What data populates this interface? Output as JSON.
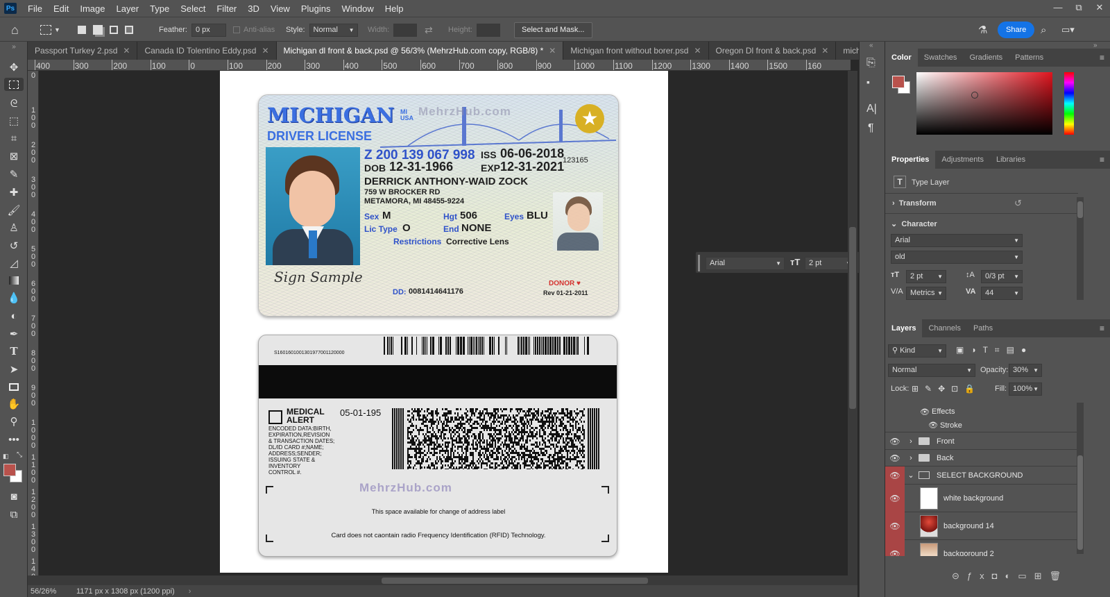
{
  "app": {
    "logo": "Ps"
  },
  "menu": [
    "File",
    "Edit",
    "Image",
    "Layer",
    "Type",
    "Select",
    "Filter",
    "3D",
    "View",
    "Plugins",
    "Window",
    "Help"
  ],
  "window_controls": {
    "minimize": "—",
    "restore": "⧉",
    "close": "✕"
  },
  "options": {
    "feather_label": "Feather:",
    "feather_value": "0 px",
    "antialias_label": "Anti-alias",
    "style_label": "Style:",
    "style_value": "Normal",
    "width_label": "Width:",
    "height_label": "Height:",
    "select_mask_label": "Select and Mask...",
    "share_label": "Share"
  },
  "tabs": [
    {
      "label": "Passport Turkey 2.psd",
      "active": false
    },
    {
      "label": "Canada ID Tolentino Eddy.psd",
      "active": false
    },
    {
      "label": "Michigan dl front & back.psd @ 56/3% (MehrzHub.com copy, RGB/8) *",
      "active": true
    },
    {
      "label": "Michigan front without borer.psd",
      "active": false
    },
    {
      "label": "Oregon Dl front & back.psd",
      "active": false
    },
    {
      "label": "michig",
      "active": false
    }
  ],
  "ruler_h": [
    "400",
    "300",
    "200",
    "100",
    "0",
    "100",
    "200",
    "300",
    "400",
    "500",
    "600",
    "700",
    "800",
    "900",
    "1000",
    "1100",
    "1200",
    "1300",
    "1400",
    "1500",
    "160"
  ],
  "ruler_v": [
    "0",
    "1\n0\n0",
    "2\n0\n0",
    "3\n0\n0",
    "4\n0\n0",
    "5\n0\n0",
    "6\n0\n0",
    "7\n0\n0",
    "8\n0\n0",
    "9\n0\n0",
    "1\n0\n0\n0",
    "1\n1\n0\n0",
    "1\n2\n0\n0",
    "1\n3\n0\n0",
    "1\n4\n0\n0"
  ],
  "card_front": {
    "state": "MICHIGAN",
    "state_sub_1": "MI",
    "state_sub_2": "USA",
    "watermark": "MehrzHub.com",
    "doc_type": "DRIVER LICENSE",
    "license_no": "Z 200 139 067 998",
    "iss_label": "ISS",
    "iss": "06-06-2018",
    "dob_label": "DOB",
    "dob": "12-31-1966",
    "exp_label": "EXP",
    "exp": "12-31-2021",
    "number_small": "123165",
    "name": "DERRICK ANTHONY-WAID ZOCK",
    "address1": "759 W BROCKER RD",
    "address2": "METAMORA, MI 48455-9224",
    "sex_label": "Sex",
    "sex": "M",
    "hgt_label": "Hgt",
    "hgt": "506",
    "eyes_label": "Eyes",
    "eyes": "BLU",
    "lictype_label": "Lic Type",
    "lictype": "O",
    "end_label": "End",
    "end": "NONE",
    "restrictions_label": "Restrictions",
    "restrictions": "Corrective Lens",
    "signature": "Sign Sample",
    "dd_label": "DD:",
    "dd": "0081414641176",
    "donor": "DONOR",
    "rev": "Rev 01-21-2011"
  },
  "card_back": {
    "code": "S1601601001301977001120000",
    "medical_1": "MEDICAL",
    "medical_2": "ALERT",
    "encoded": [
      "ENCODED DATA:BIRTH,",
      "EXPIRATION,REVISION",
      "& TRANSACTION DATES;",
      "DL/ID CARD #;NAME;",
      "ADDRESS;SENDER;",
      "ISSUING STATE &",
      "INVENTORY",
      "CONTROL #."
    ],
    "date": "05-01-195",
    "watermark": "MehrzHub.com",
    "address_note": "This space available for change of address label",
    "rfid_note": "Card does not caontain radio Frequency Identification (RFID) Technology."
  },
  "status": {
    "zoom": "56/26%",
    "dimensions": "1171 px x 1308 px (1200 ppi)"
  },
  "floatbar": {
    "font": "Arial",
    "size": "2 pt"
  },
  "color_panel": {
    "tabs": [
      "Color",
      "Swatches",
      "Gradients",
      "Patterns"
    ],
    "fg": "#b9524c",
    "bg": "#ffffff",
    "hue": "#e0141e"
  },
  "properties_panel": {
    "tabs": [
      "Properties",
      "Adjustments",
      "Libraries"
    ],
    "type_layer": "Type Layer",
    "transform": "Transform",
    "character": "Character",
    "font_family": "Arial",
    "font_style": "old",
    "font_size": "2 pt",
    "leading": "0/3 pt",
    "kerning": "Metrics",
    "tracking": "44"
  },
  "layers_panel": {
    "tabs": [
      "Layers",
      "Channels",
      "Paths"
    ],
    "filter": "Kind",
    "blend_mode": "Normal",
    "opacity_label": "Opacity:",
    "opacity": "30%",
    "lock_label": "Lock:",
    "fill_label": "Fill:",
    "fill": "100%",
    "layers": [
      {
        "name": "Effects",
        "kind": "effects"
      },
      {
        "name": "Stroke",
        "kind": "effect"
      },
      {
        "name": "Front",
        "kind": "group"
      },
      {
        "name": "Back",
        "kind": "group"
      },
      {
        "name": "SELECT BACKGROUND",
        "kind": "group-open"
      },
      {
        "name": "white background",
        "kind": "image"
      },
      {
        "name": "background 14",
        "kind": "image"
      },
      {
        "name": "backgoround 2",
        "kind": "image"
      }
    ]
  }
}
